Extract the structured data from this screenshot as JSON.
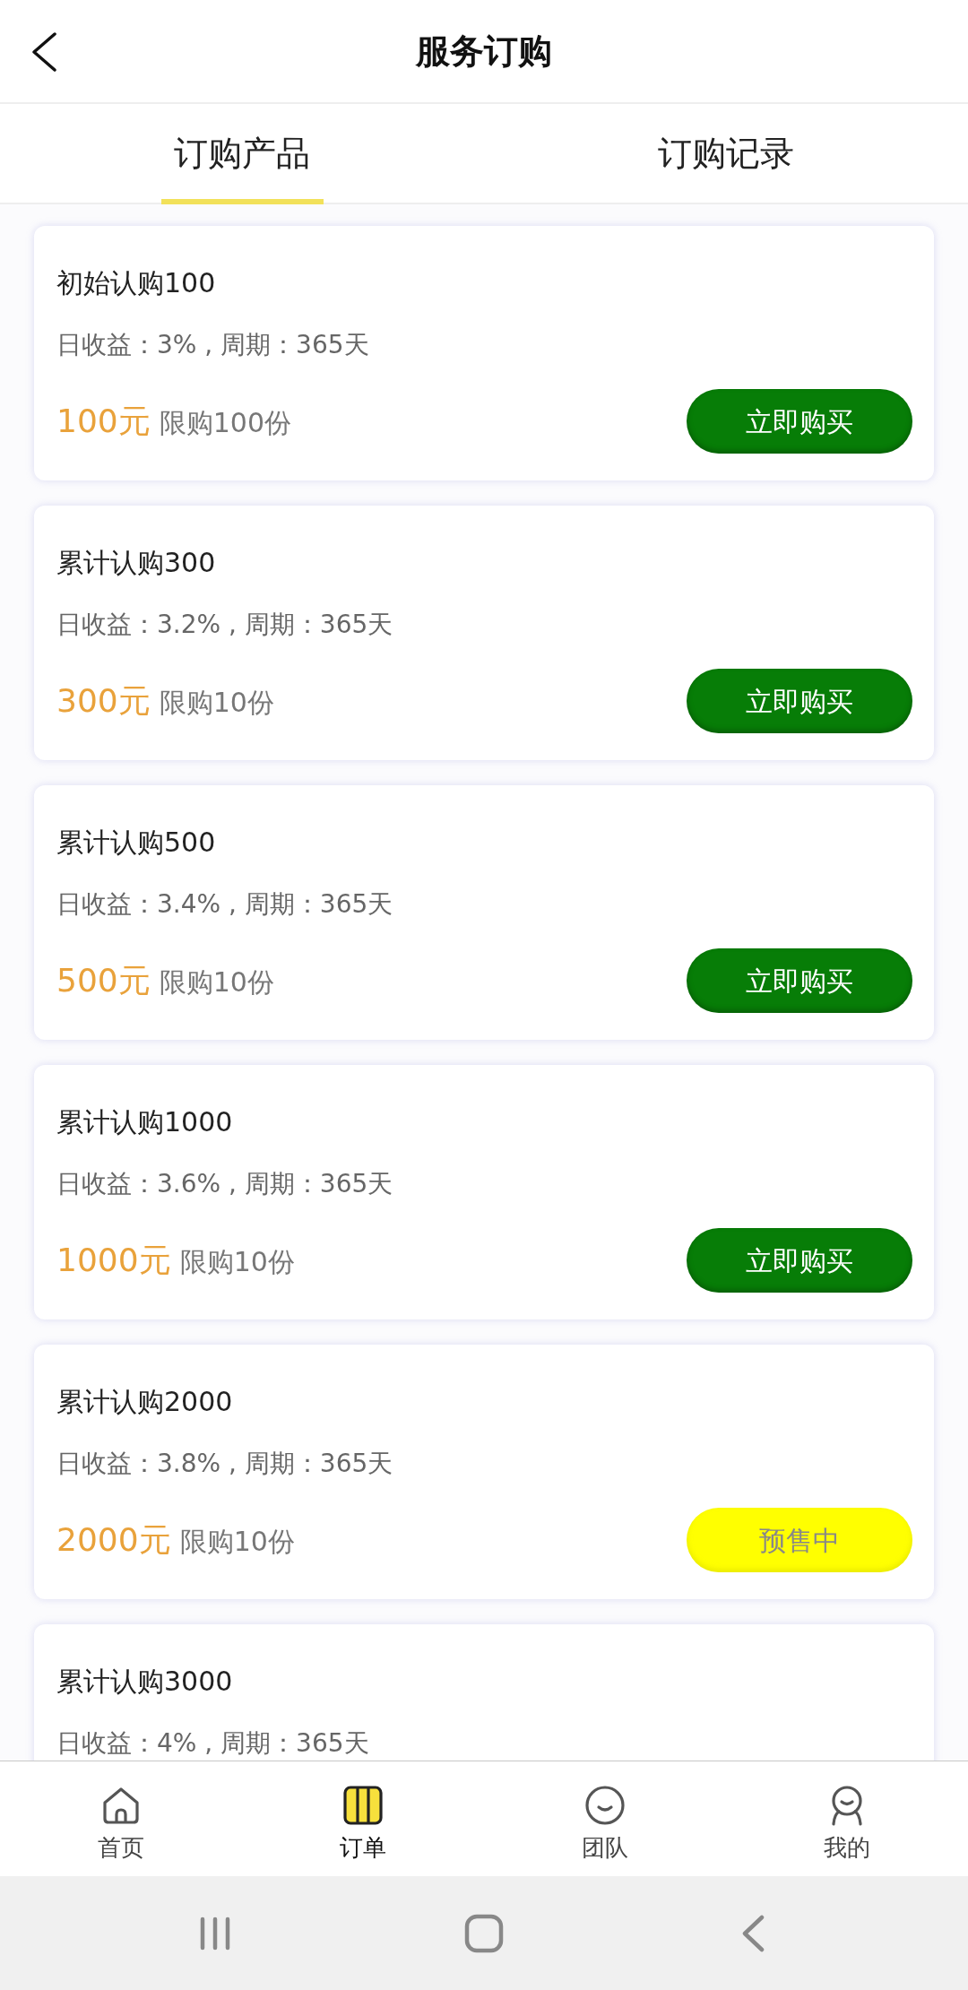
{
  "header": {
    "title": "服务订购"
  },
  "tabs": [
    {
      "label": "订购产品",
      "selected": true
    },
    {
      "label": "订购记录",
      "selected": false
    }
  ],
  "products": [
    {
      "name": "初始认购100",
      "terms": "日收益：3% , 周期：365天",
      "price": "100元",
      "limit": "限购100份",
      "action": {
        "label": "立即购买",
        "kind": "buy"
      }
    },
    {
      "name": "累计认购300",
      "terms": "日收益：3.2% , 周期：365天",
      "price": "300元",
      "limit": "限购10份",
      "action": {
        "label": "立即购买",
        "kind": "buy"
      }
    },
    {
      "name": "累计认购500",
      "terms": "日收益：3.4% , 周期：365天",
      "price": "500元",
      "limit": "限购10份",
      "action": {
        "label": "立即购买",
        "kind": "buy"
      }
    },
    {
      "name": "累计认购1000",
      "terms": "日收益：3.6% , 周期：365天",
      "price": "1000元",
      "limit": "限购10份",
      "action": {
        "label": "立即购买",
        "kind": "buy"
      }
    },
    {
      "name": "累计认购2000",
      "terms": "日收益：3.8% , 周期：365天",
      "price": "2000元",
      "limit": "限购10份",
      "action": {
        "label": "预售中",
        "kind": "presale"
      }
    },
    {
      "name": "累计认购3000",
      "terms": "日收益：4% , 周期：365天"
    }
  ],
  "tab_bar": [
    {
      "label": "首页",
      "selected": false
    },
    {
      "label": "订单",
      "selected": true
    },
    {
      "label": "团队",
      "selected": false
    },
    {
      "label": "我的",
      "selected": false
    }
  ]
}
